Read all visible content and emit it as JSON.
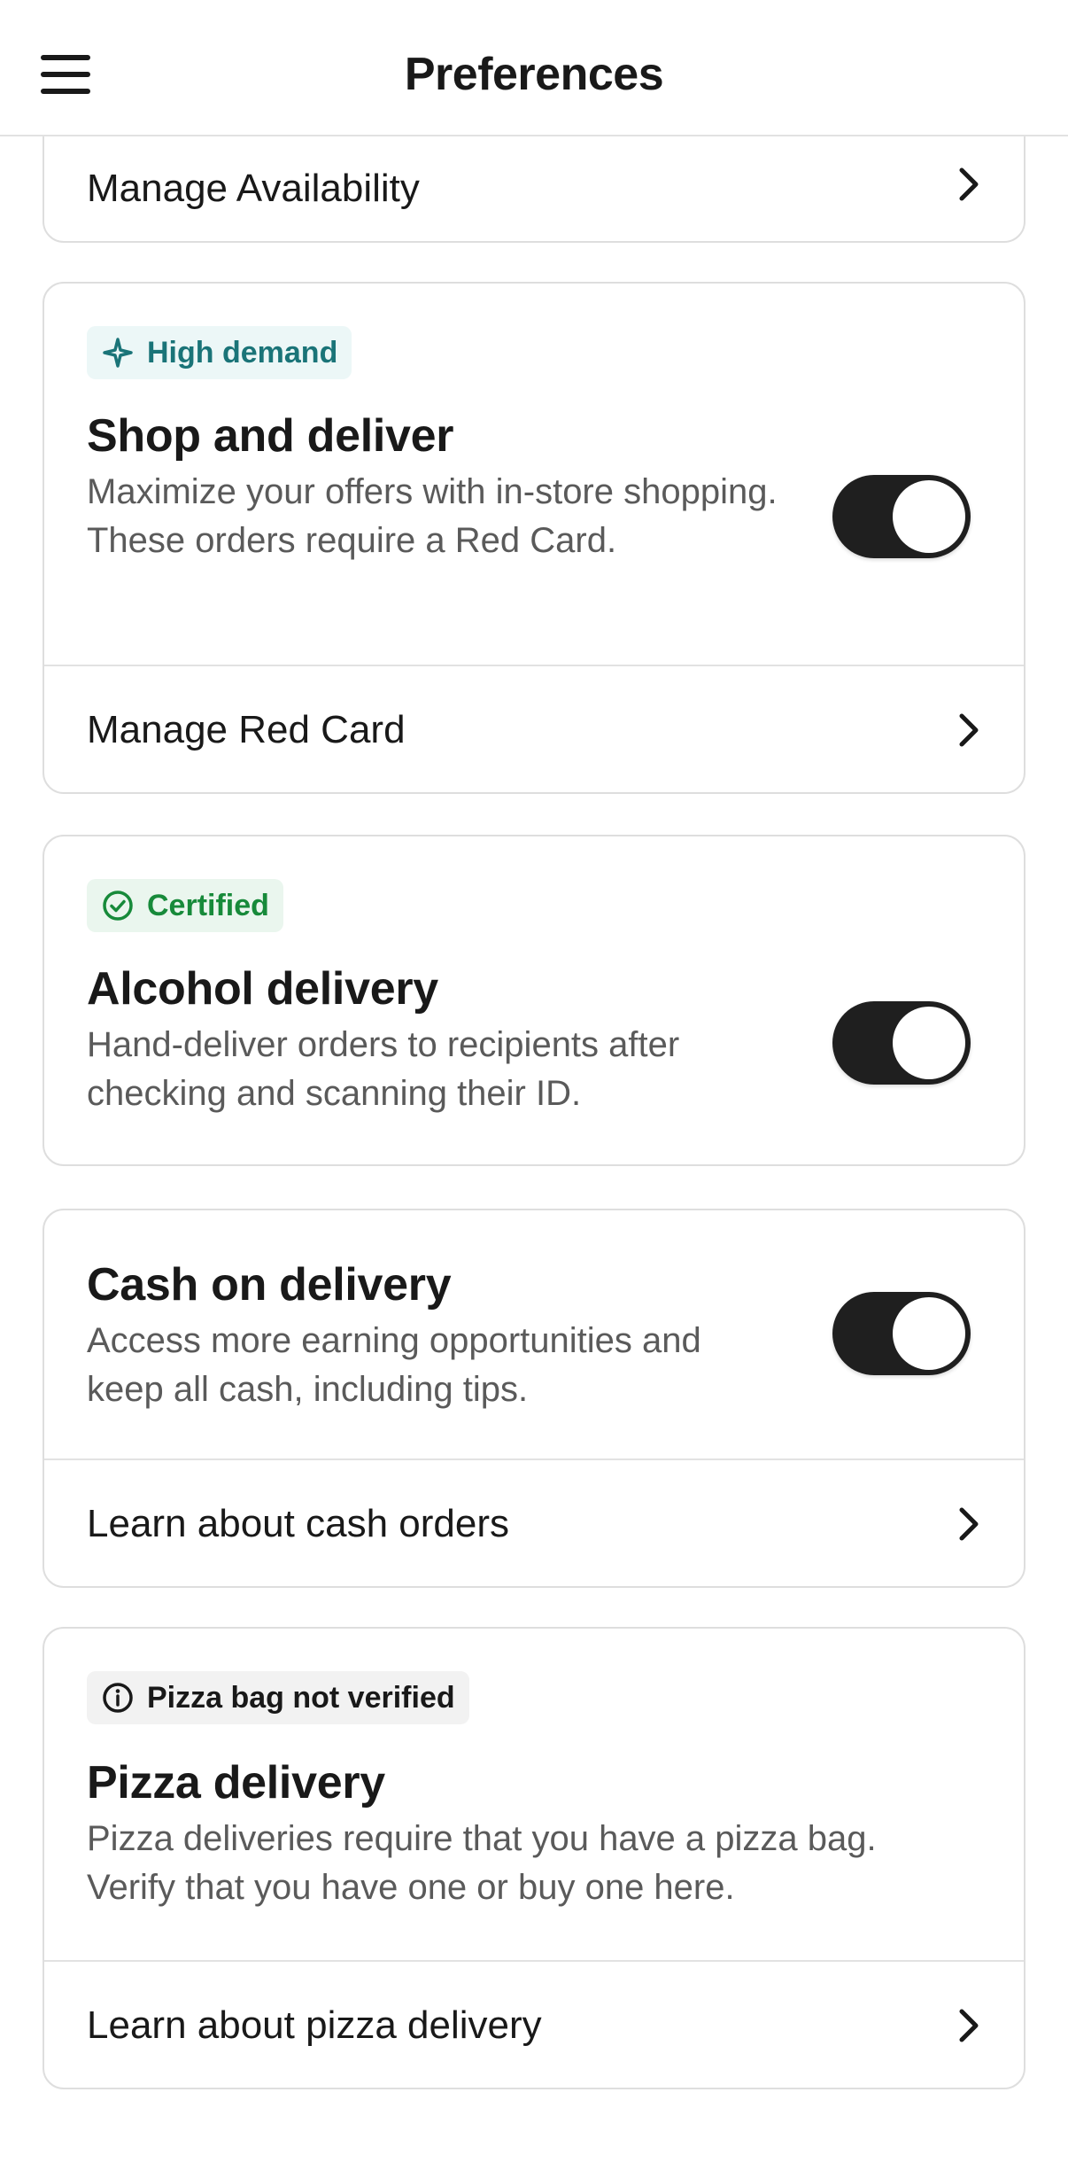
{
  "header": {
    "title": "Preferences",
    "menu_icon": "hamburger-menu-icon"
  },
  "availability": {
    "label": "Manage Availability"
  },
  "shop": {
    "badge": "High demand",
    "title": "Shop and deliver",
    "description": "Maximize your offers with in-store shopping. These orders require a Red Card.",
    "toggle_on": true,
    "link_label": "Manage Red Card"
  },
  "alcohol": {
    "badge": "Certified",
    "title": "Alcohol delivery",
    "description": "Hand-deliver orders to recipients after checking and scanning their ID.",
    "toggle_on": true
  },
  "cash": {
    "title": "Cash on delivery",
    "description": "Access more earning opportunities and keep all cash, including tips.",
    "toggle_on": true,
    "link_label": "Learn about cash orders"
  },
  "pizza": {
    "badge": "Pizza bag not verified",
    "title": "Pizza delivery",
    "description": "Pizza deliveries require that you have a pizza bag. Verify that you have one or buy one here.",
    "link_label": "Learn about pizza delivery"
  },
  "colors": {
    "toggle_on": "#1f1f1f",
    "teal_badge_text": "#1a7478",
    "green_badge_text": "#178a3a"
  }
}
